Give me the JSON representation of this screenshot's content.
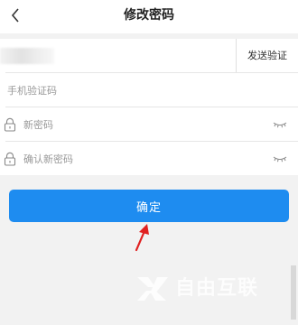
{
  "header": {
    "back_icon": "chevron-left-icon",
    "title": "修改密码"
  },
  "form": {
    "phone_row": {
      "value_obscured": true,
      "send_button_label": "发送验证"
    },
    "code_row": {
      "placeholder": "手机验证码"
    },
    "new_password_row": {
      "placeholder": "新密码",
      "leading_icon": "lock-icon",
      "trailing_icon": "eye-closed-icon"
    },
    "confirm_password_row": {
      "placeholder": "确认新密码",
      "leading_icon": "lock-icon",
      "trailing_icon": "eye-closed-icon"
    }
  },
  "confirm_button": {
    "label": "确定"
  },
  "annotation": {
    "arrow_icon": "red-arrow-icon"
  },
  "watermark": {
    "text": "自由互联"
  },
  "colors": {
    "background": "#f2f2f2",
    "card": "#ffffff",
    "primary": "#1e8cf0",
    "arrow": "#e02020",
    "placeholder": "#999999"
  }
}
